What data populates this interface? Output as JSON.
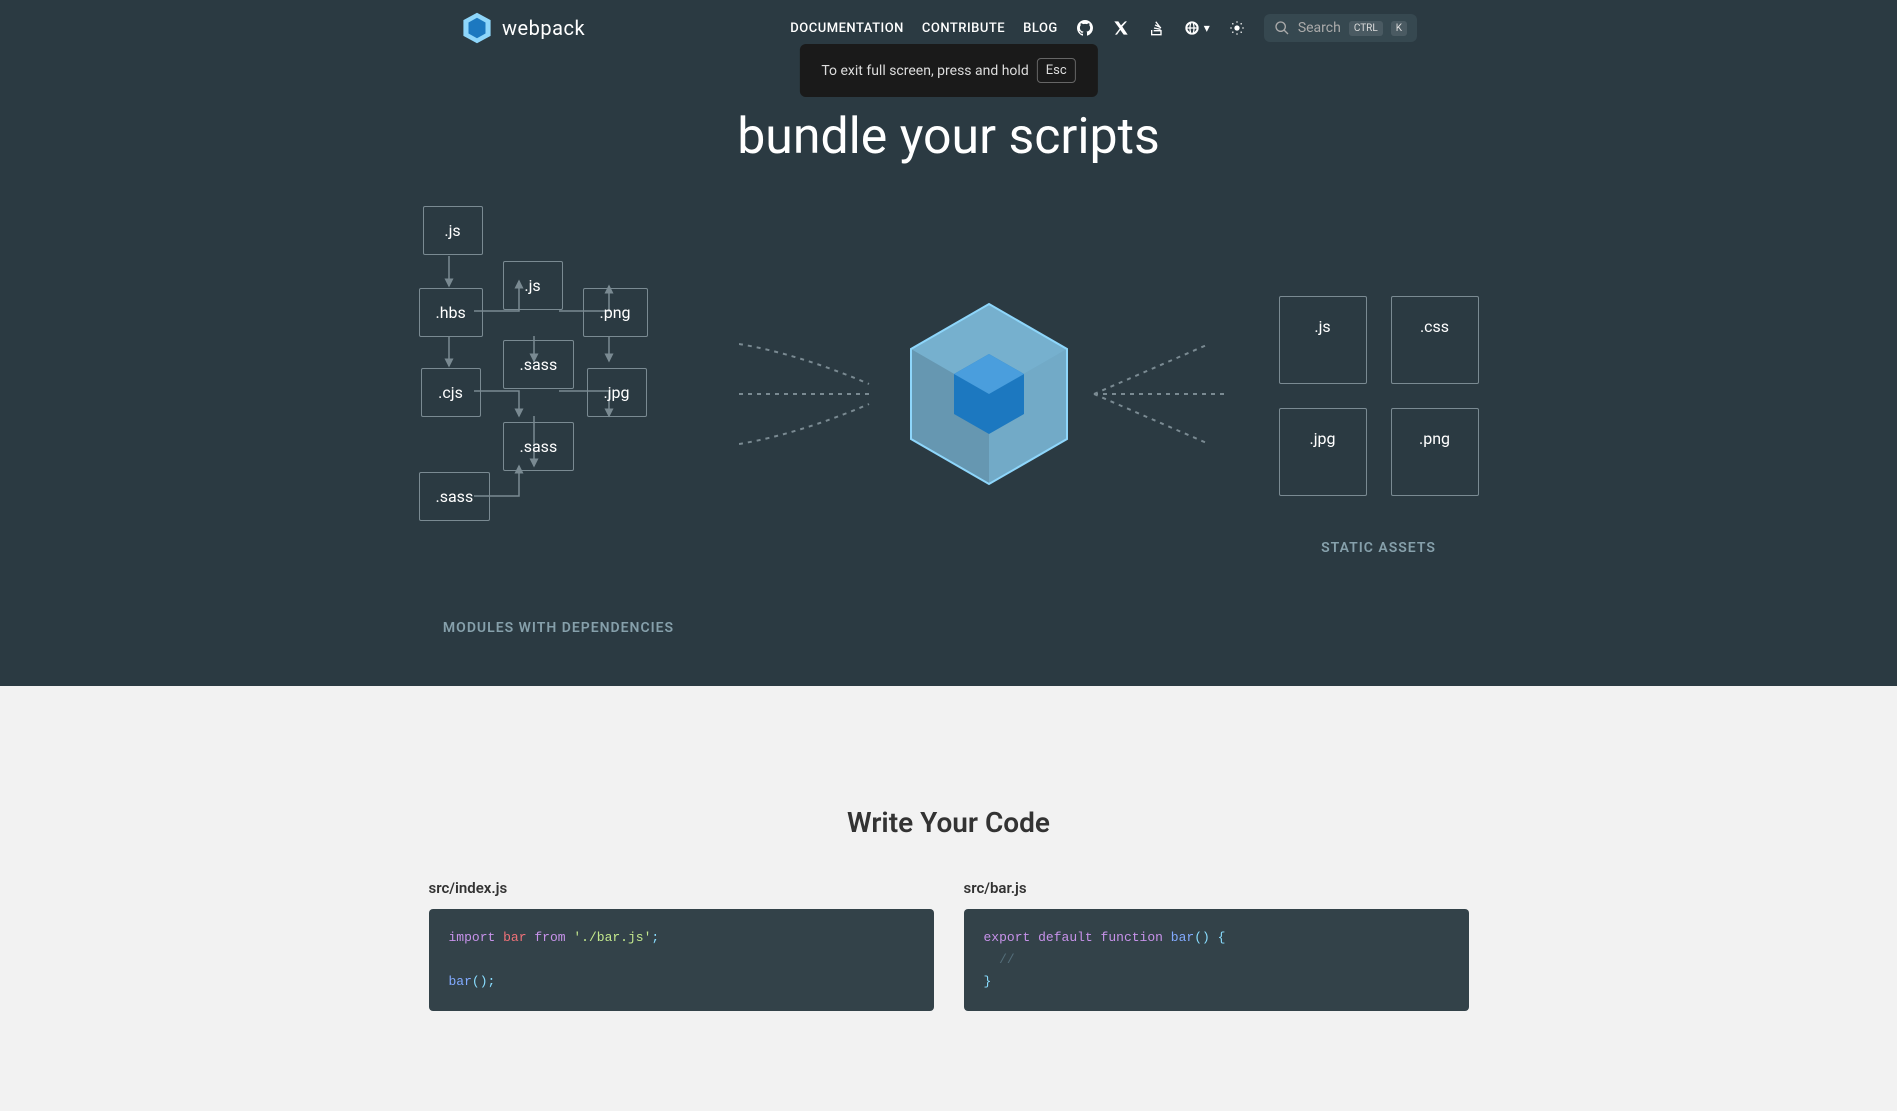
{
  "header": {
    "brand": "webpack",
    "nav": {
      "documentation": "DOCUMENTATION",
      "contribute": "CONTRIBUTE",
      "blog": "BLOG"
    },
    "search": {
      "placeholder": "Search",
      "kbd1": "CTRL",
      "kbd2": "K"
    },
    "lang": "▾"
  },
  "fullscreen_notice": {
    "text": "To exit full screen, press and hold",
    "key": "Esc"
  },
  "hero": {
    "title_prefix": "bundle your ",
    "title_word": "scripts"
  },
  "diagram": {
    "modules": {
      "js1": ".js",
      "js2": ".js",
      "hbs": ".hbs",
      "png": ".png",
      "sass1": ".sass",
      "cjs": ".cjs",
      "jpg": ".jpg",
      "sass2": ".sass",
      "sass3": ".sass",
      "label": "MODULES WITH DEPENDENCIES"
    },
    "assets": {
      "js": ".js",
      "css": ".css",
      "jpg": ".jpg",
      "png": ".png",
      "label": "STATIC ASSETS"
    }
  },
  "code_section": {
    "title": "Write Your Code",
    "left": {
      "filename": "src/index.js",
      "tokens": {
        "import": "import",
        "bar1": "bar",
        "from": "from",
        "path": "'./bar.js'",
        "semi1": ";",
        "bar2": "bar",
        "call": "();"
      }
    },
    "right": {
      "filename": "src/bar.js",
      "tokens": {
        "export": "export",
        "default": "default",
        "function": "function",
        "bar": "bar",
        "paren": "() {",
        "comment": "//",
        "close": "}"
      }
    }
  }
}
